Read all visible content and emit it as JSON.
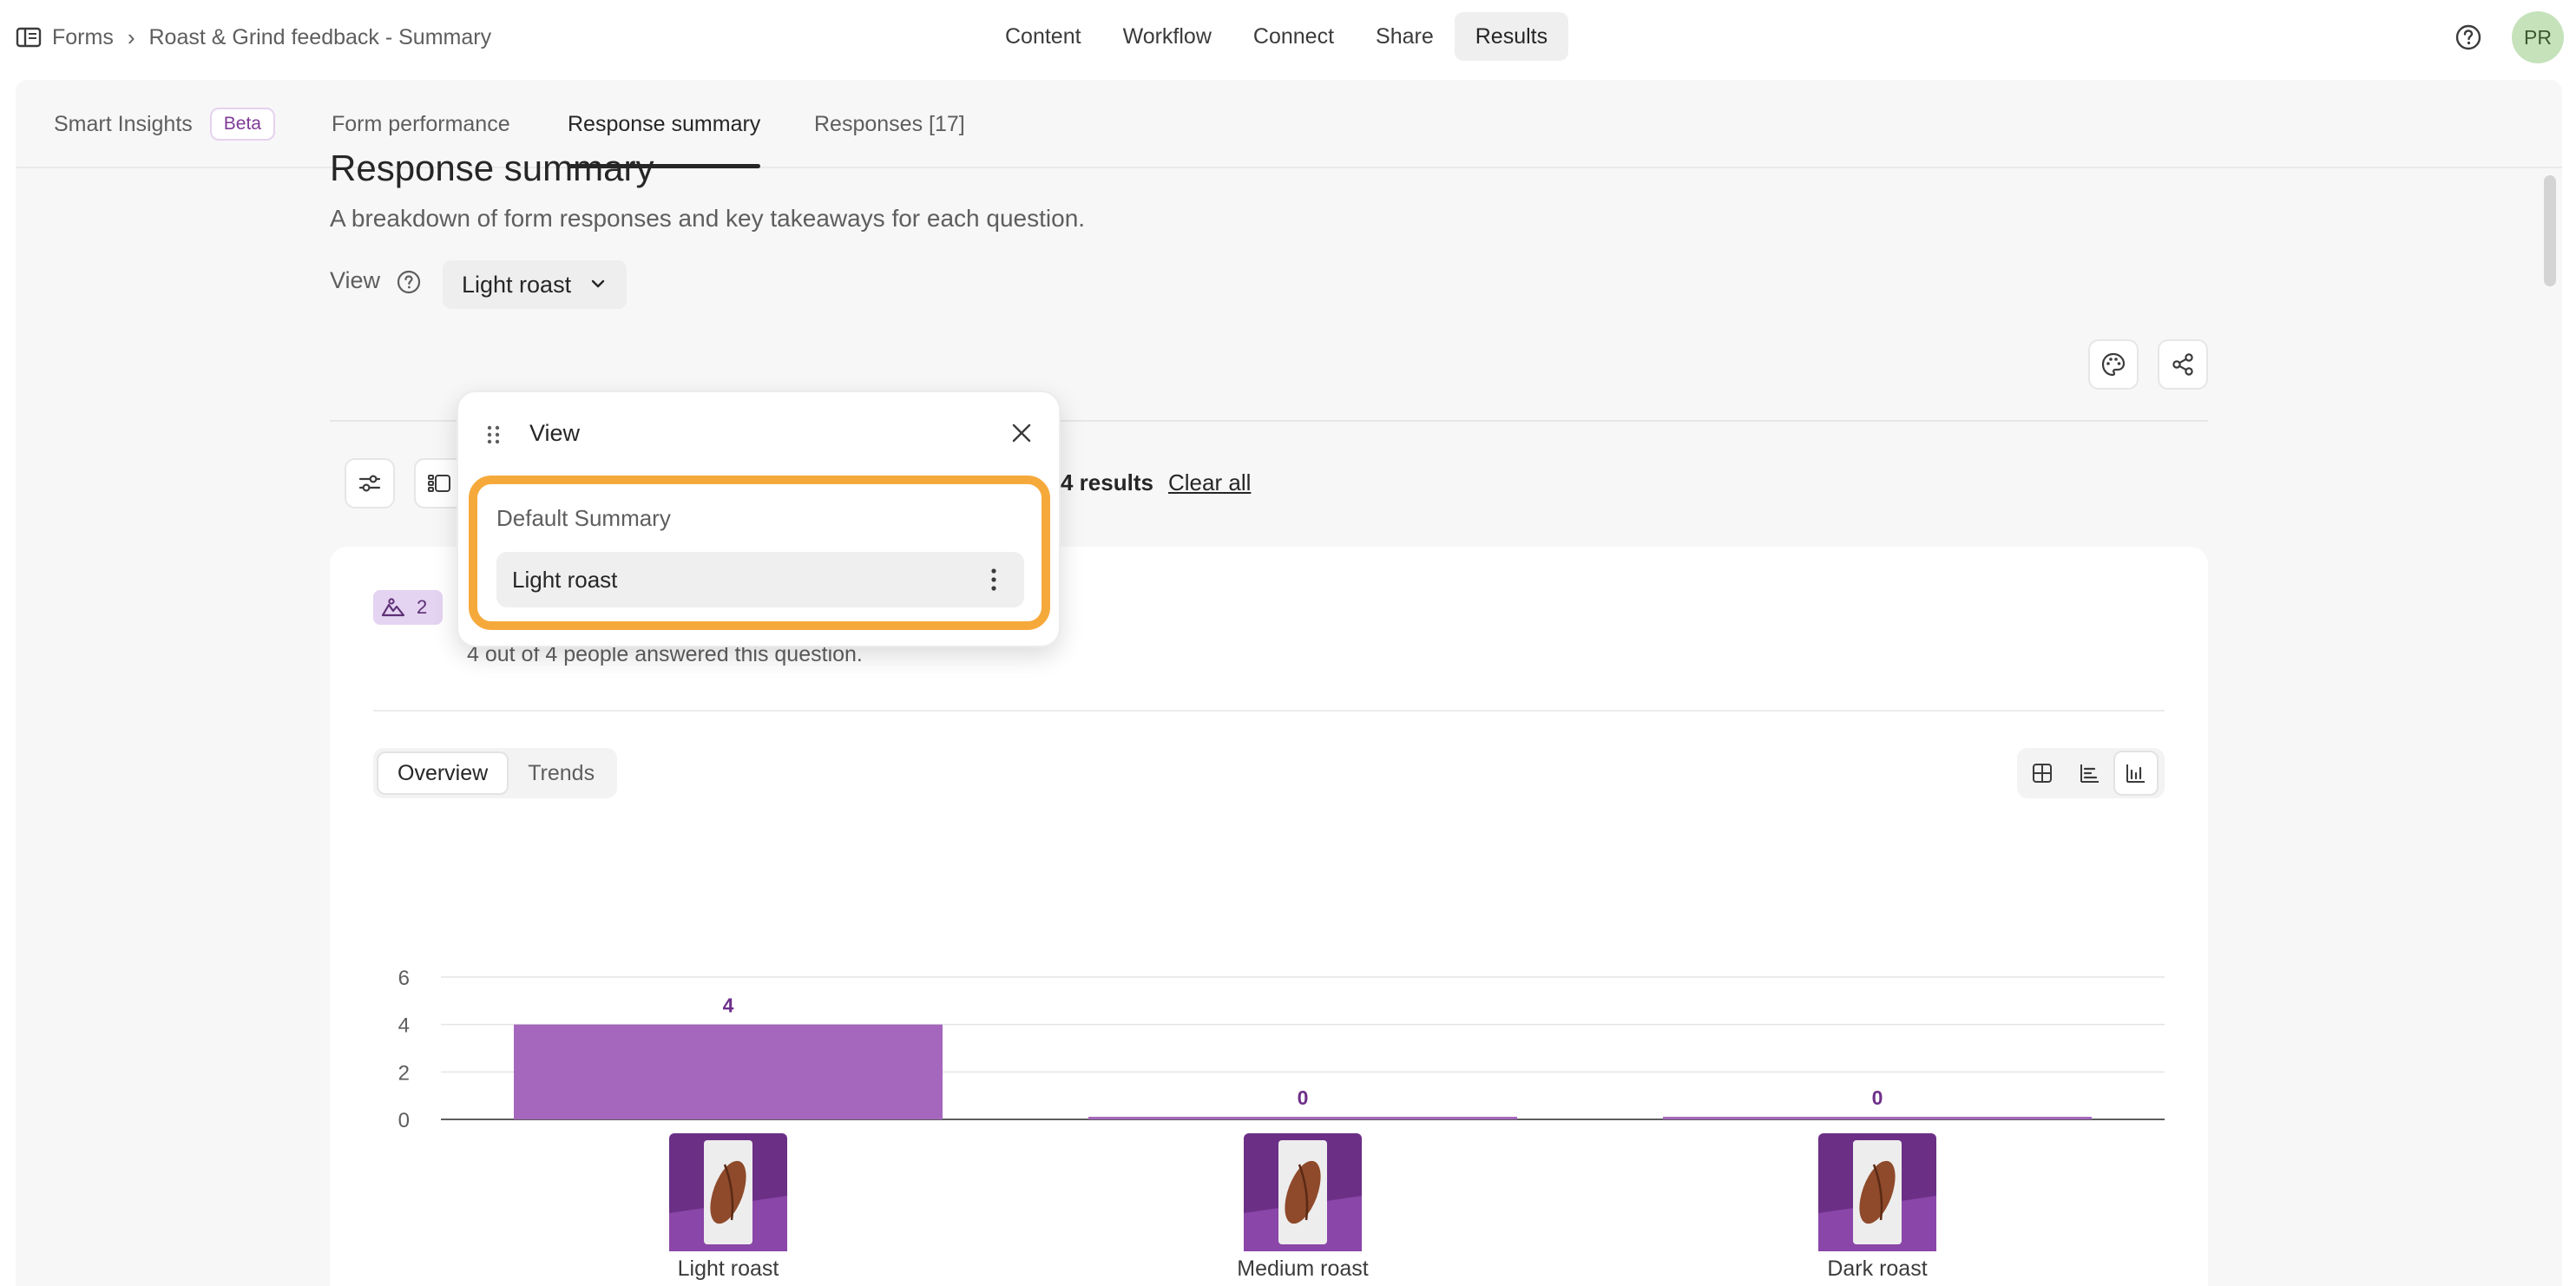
{
  "header": {
    "breadcrumb_root": "Forms",
    "breadcrumb_separator": "›",
    "breadcrumb_page": "Roast & Grind feedback - Summary",
    "nav": [
      "Content",
      "Workflow",
      "Connect",
      "Share",
      "Results"
    ],
    "nav_active": "Results",
    "avatar_initials": "PR"
  },
  "subtabs": {
    "smart_insights": "Smart Insights",
    "beta": "Beta",
    "form_performance": "Form performance",
    "response_summary": "Response summary",
    "responses": "Responses [17]"
  },
  "summary": {
    "title": "Response summary",
    "description": "A breakdown of form responses and key takeaways for each question.",
    "view_label": "View",
    "view_selected": "Light roast",
    "results_count": "4 results",
    "clear_all": "Clear all"
  },
  "question": {
    "badge_number": "2",
    "answered_text": "4 out of 4 people answered this question.",
    "tabs": [
      "Overview",
      "Trends"
    ],
    "active_tab": "Overview"
  },
  "popover": {
    "title": "View",
    "items": [
      "Default Summary",
      "Light roast"
    ],
    "selected": "Light roast"
  },
  "chart_data": {
    "type": "bar",
    "categories": [
      "Light roast",
      "Medium roast",
      "Dark roast"
    ],
    "values": [
      4,
      0,
      0
    ],
    "y_ticks": [
      0,
      2,
      4,
      6
    ],
    "ylim": [
      0,
      6
    ],
    "bar_color": "#a566bd",
    "label_color": "#6e2f8a",
    "grid": true
  },
  "colors": {
    "accent_purple": "#a566bd",
    "highlight_orange": "#f6a93b",
    "avatar_green": "#c5e2bb"
  }
}
